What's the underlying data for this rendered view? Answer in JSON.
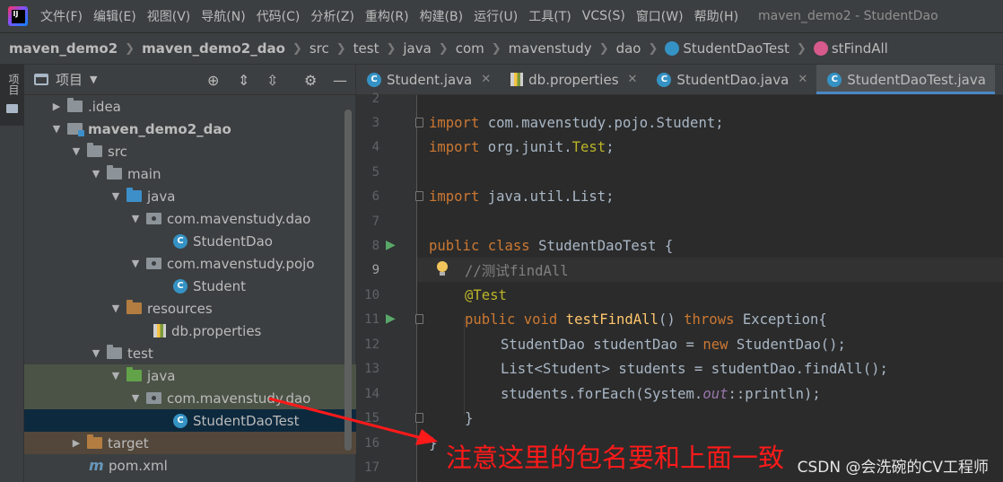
{
  "menu": {
    "items": [
      "文件(F)",
      "编辑(E)",
      "视图(V)",
      "导航(N)",
      "代码(C)",
      "分析(Z)",
      "重构(R)",
      "构建(B)",
      "运行(U)",
      "工具(T)",
      "VCS(S)",
      "窗口(W)",
      "帮助(H)"
    ],
    "window_title": "maven_demo2 - StudentDao"
  },
  "breadcrumb": [
    "maven_demo2",
    "maven_demo2_dao",
    "src",
    "test",
    "java",
    "com",
    "mavenstudy",
    "dao",
    "StudentDaoTest",
    "stFindAll"
  ],
  "tool_strip": {
    "project_label": "项目"
  },
  "project_panel": {
    "title": "项目",
    "tree": [
      {
        "label": ".idea"
      },
      {
        "label": "maven_demo2_dao"
      },
      {
        "label": "src"
      },
      {
        "label": "main"
      },
      {
        "label": "java"
      },
      {
        "label": "com.mavenstudy.dao"
      },
      {
        "label": "StudentDao"
      },
      {
        "label": "com.mavenstudy.pojo"
      },
      {
        "label": "Student"
      },
      {
        "label": "resources"
      },
      {
        "label": "db.properties"
      },
      {
        "label": "test"
      },
      {
        "label": "java"
      },
      {
        "label": "com.mavenstudy.dao"
      },
      {
        "label": "StudentDaoTest"
      },
      {
        "label": "target"
      },
      {
        "label": "pom.xml"
      }
    ]
  },
  "tabs": [
    {
      "label": "Student.java",
      "icon": "class-icon"
    },
    {
      "label": "db.properties",
      "icon": "properties-icon"
    },
    {
      "label": "StudentDao.java",
      "icon": "class-icon"
    },
    {
      "label": "StudentDaoTest.java",
      "icon": "test-class-icon",
      "active": true
    }
  ],
  "editor": {
    "current_line": 9,
    "line_numbers": [
      "2",
      "3",
      "4",
      "5",
      "6",
      "7",
      "8",
      "9",
      "10",
      "11",
      "12",
      "13",
      "14",
      "15",
      "16",
      "17"
    ],
    "code": {
      "l3": {
        "k": "import",
        "t": " com.mavenstudy.pojo.Student;"
      },
      "l4": {
        "k": "import",
        "t1": " org.junit.",
        "a": "Test",
        "t2": ";"
      },
      "l6": {
        "k": "import",
        "t": " java.util.List;"
      },
      "l8": {
        "k1": "public",
        "k2": " class",
        "t": " StudentDaoTest {"
      },
      "l9": {
        "c": "//测试findAll"
      },
      "l10": {
        "a": "@Test"
      },
      "l11": {
        "k1": "public",
        "k2": " void",
        "f": " testFindAll",
        "t1": "() ",
        "k3": "throws",
        "t2": " Exception{"
      },
      "l12": {
        "t1": "StudentDao studentDao = ",
        "k": "new",
        "t2": " StudentDao();"
      },
      "l13": {
        "t": "List<Student> students = studentDao.findAll();"
      },
      "l14": {
        "t1": "students.forEach(System.",
        "fld": "out",
        "t2": "::println);"
      },
      "l15": {
        "t": "}"
      },
      "l16": {
        "t": "}"
      }
    }
  },
  "annotation": {
    "text": "注意这里的包名要和上面一致",
    "color": "#ff1a1a"
  },
  "watermark": "CSDN @会洗碗的CV工程师",
  "colors": {
    "accent": "#4a88c7",
    "keyword": "#cc7832",
    "annotation_code": "#bbb529",
    "method": "#ffc66d",
    "comment": "#808080"
  }
}
